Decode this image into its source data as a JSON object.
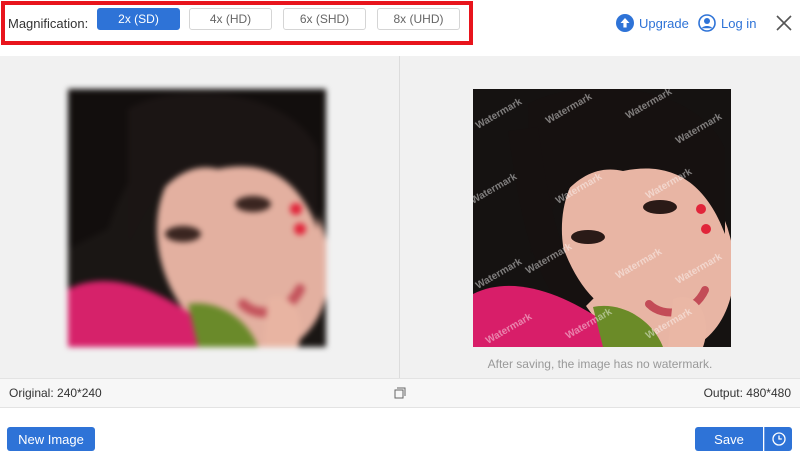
{
  "magnification": {
    "label": "Magnification:",
    "options": [
      {
        "label": "2x (SD)",
        "active": true
      },
      {
        "label": "4x (HD)",
        "active": false
      },
      {
        "label": "6x (SHD)",
        "active": false
      },
      {
        "label": "8x (UHD)",
        "active": false
      }
    ]
  },
  "header": {
    "upgrade_label": "Upgrade",
    "login_label": "Log in"
  },
  "preview": {
    "watermark_text": "Watermark",
    "note": "After saving, the image has no watermark."
  },
  "info": {
    "original": "Original: 240*240",
    "output": "Output: 480*480"
  },
  "actions": {
    "new_image_label": "New Image",
    "save_label": "Save"
  },
  "colors": {
    "accent": "#2e73d7",
    "highlight_border": "#e8141c"
  }
}
